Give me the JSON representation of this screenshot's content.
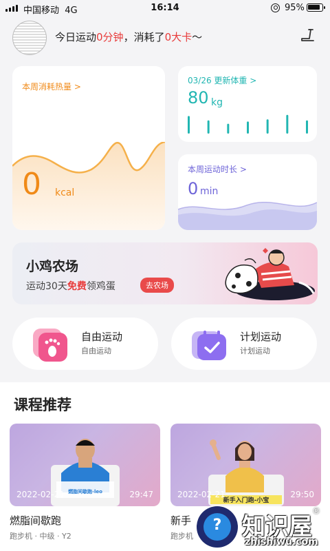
{
  "status_bar": {
    "carrier": "中国移动",
    "network": "4G",
    "time": "16:14",
    "battery": "95%"
  },
  "header": {
    "greeting_prefix": "今日运动",
    "minutes_value": "0分钟",
    "greeting_mid": "，消耗了",
    "kcal_value": "0大卡",
    "greeting_suffix": "～"
  },
  "calorie_card": {
    "title": "本周消耗热量",
    "value": "0",
    "unit": "kcal",
    "arrow": ">"
  },
  "weight_card": {
    "title": "03/26 更新体重",
    "value": "80",
    "unit": "kg",
    "arrow": ">",
    "bar_levels": [
      0.8,
      0.6,
      0.45,
      0.55,
      0.65,
      0.85,
      0.6
    ]
  },
  "time_card": {
    "title": "本周运动时长",
    "value": "0",
    "unit": "min",
    "arrow": ">"
  },
  "farm_banner": {
    "title": "小鸡农场",
    "sub_prefix": "运动30天",
    "sub_free": "免费",
    "sub_suffix": "领鸡蛋",
    "button": "去农场"
  },
  "sports": [
    {
      "name": "自由运动",
      "sub": "自由运动",
      "icon": "footprint-icon"
    },
    {
      "name": "计划运动",
      "sub": "计划运动",
      "icon": "calendar-check-icon"
    }
  ],
  "courses_title": "课程推荐",
  "courses": [
    {
      "date": "2022-02-21",
      "duration": "29:47",
      "name": "燃脂间歇跑",
      "meta": "跑步机 · 中级 · Y2",
      "caption": "燃脂间歇跑-leo"
    },
    {
      "date": "2022-02-21",
      "duration": "29:50",
      "name": "新手",
      "meta": "跑步机",
      "caption": "新手入门跑-小宝"
    }
  ],
  "watermark": {
    "name": "知识屋",
    "url": "zhishiwu.com",
    "mark": "®",
    "glyph": "?"
  },
  "colors": {
    "orange": "#f08a18",
    "teal": "#21b6b2",
    "purple": "#6e64d8",
    "red": "#e83a3a"
  }
}
